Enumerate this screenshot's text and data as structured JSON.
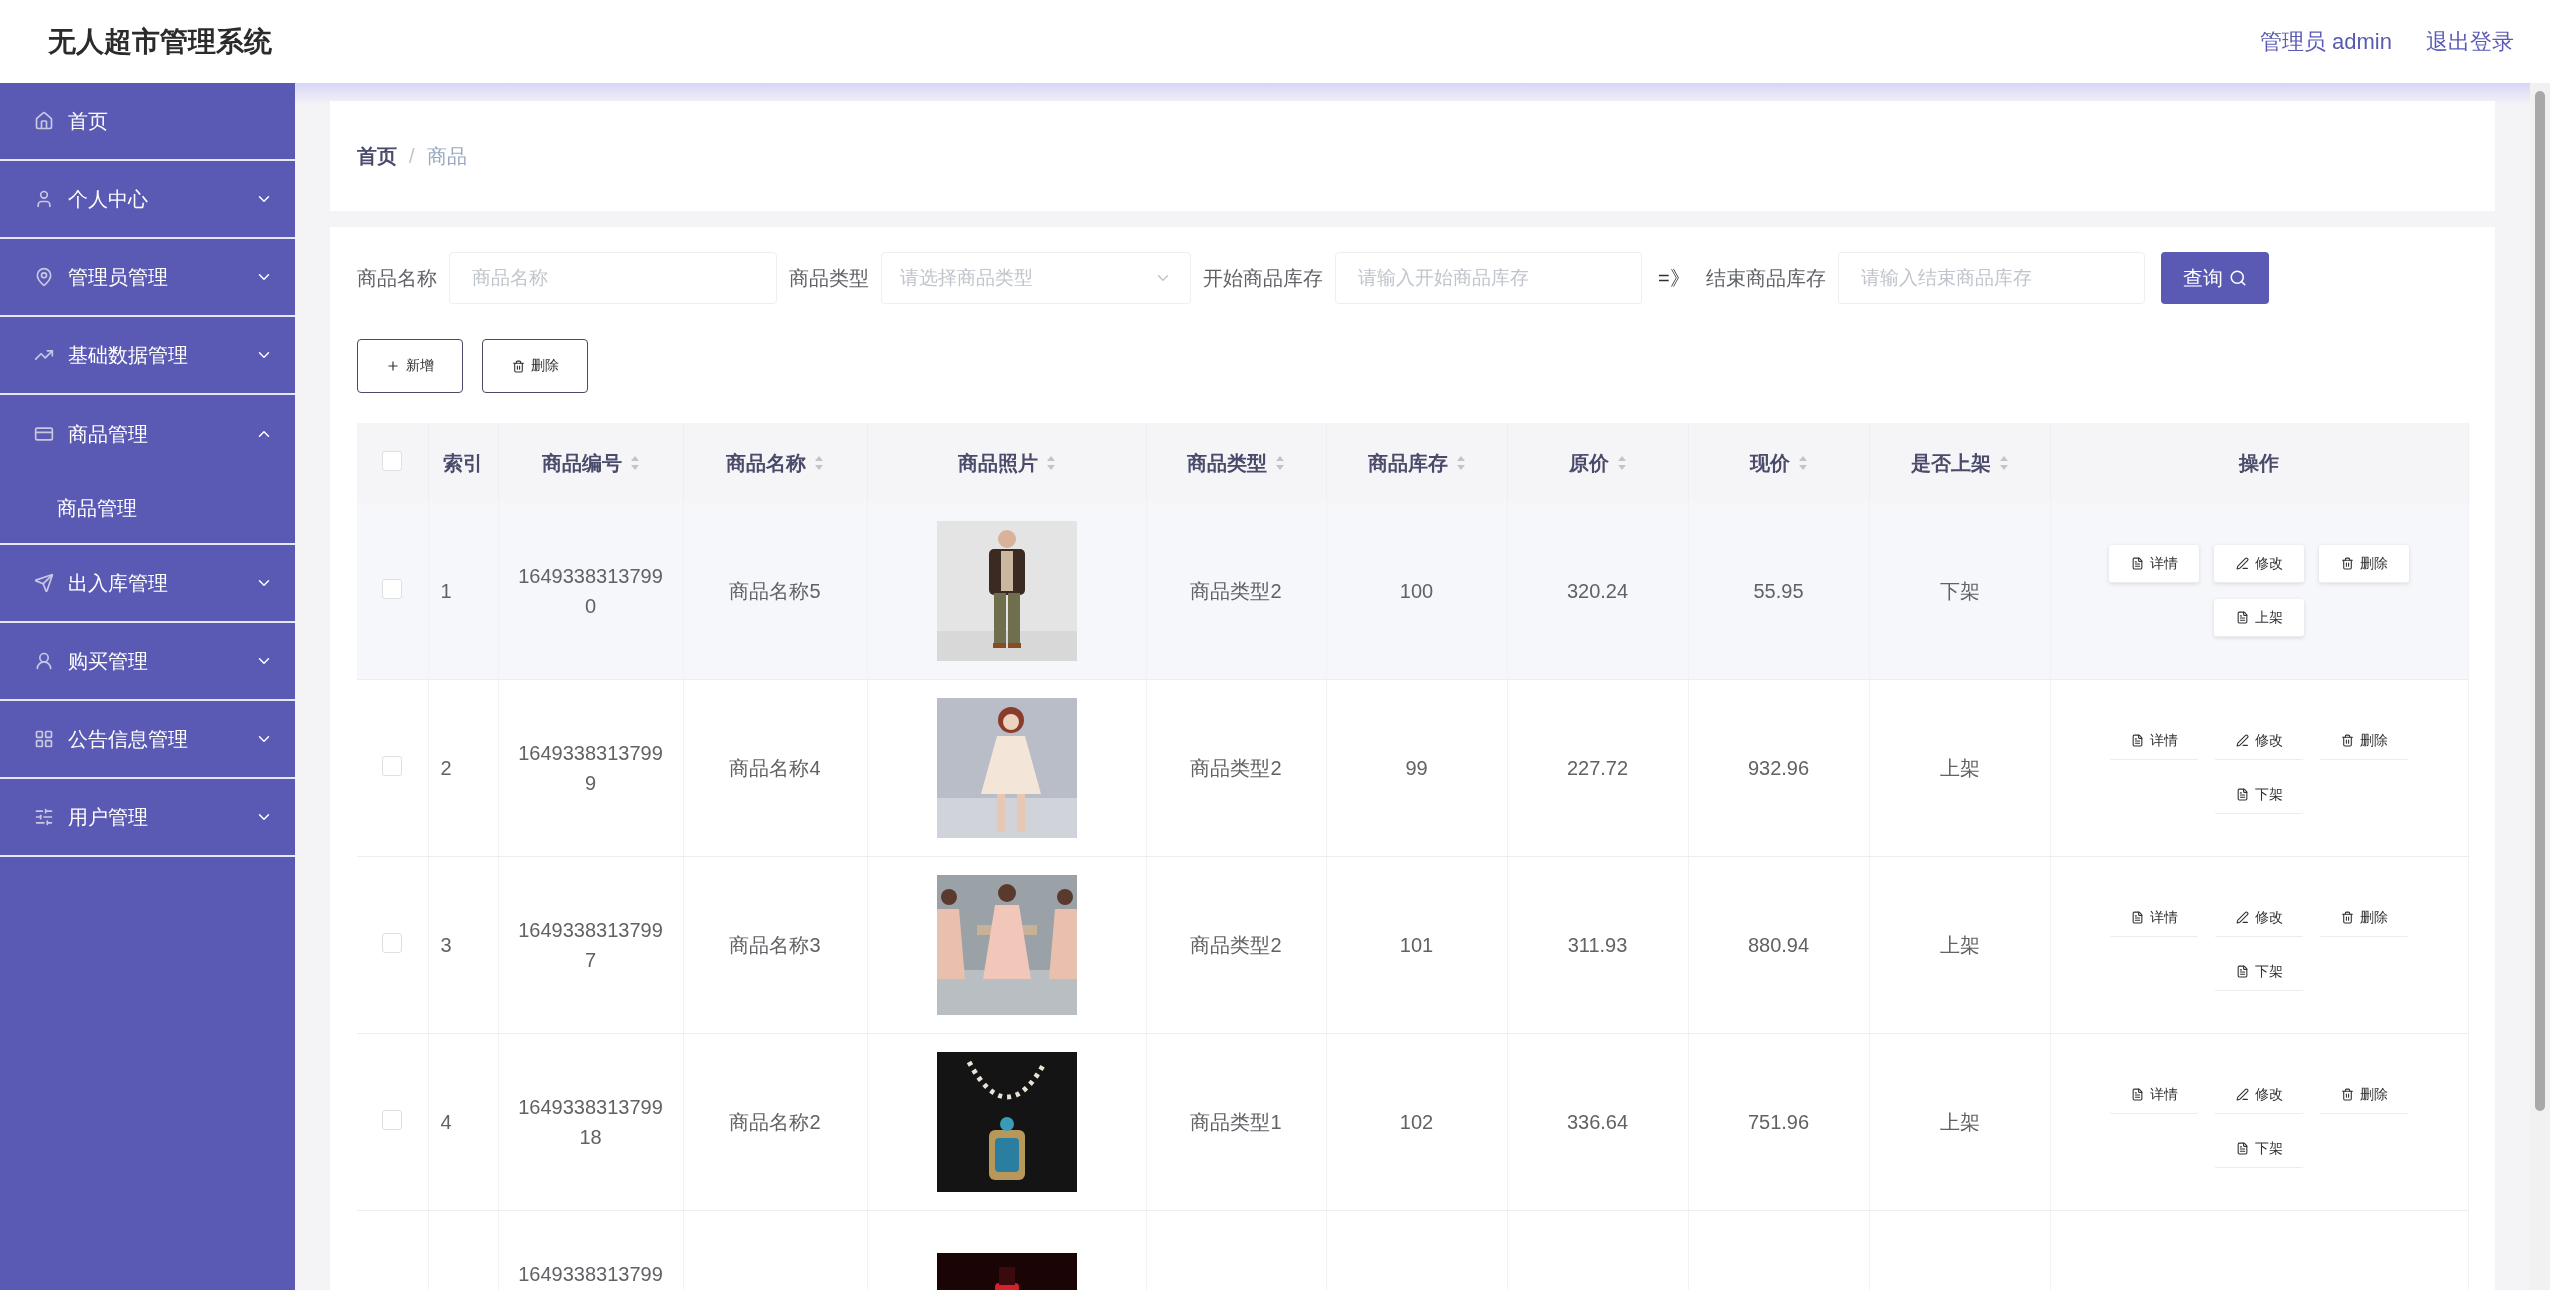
{
  "header": {
    "title": "无人超市管理系统",
    "user": "管理员 admin",
    "logout": "退出登录"
  },
  "sidebar": {
    "items": [
      {
        "label": "首页",
        "kind": "link"
      },
      {
        "label": "个人中心",
        "kind": "menu",
        "expanded": false
      },
      {
        "label": "管理员管理",
        "kind": "menu",
        "expanded": false
      },
      {
        "label": "基础数据管理",
        "kind": "menu",
        "expanded": false
      },
      {
        "label": "商品管理",
        "kind": "menu",
        "expanded": true,
        "children": [
          {
            "label": "商品管理"
          }
        ]
      },
      {
        "label": "出入库管理",
        "kind": "menu",
        "expanded": false
      },
      {
        "label": "购买管理",
        "kind": "menu",
        "expanded": false
      },
      {
        "label": "公告信息管理",
        "kind": "menu",
        "expanded": false
      },
      {
        "label": "用户管理",
        "kind": "menu",
        "expanded": false
      }
    ]
  },
  "breadcrumb": {
    "items": [
      "首页",
      "商品"
    ],
    "separator": "/"
  },
  "search": {
    "fields": [
      {
        "label": "商品名称",
        "kind": "input",
        "placeholder": "商品名称"
      },
      {
        "label": "商品类型",
        "kind": "select",
        "placeholder": "请选择商品类型"
      },
      {
        "label": "开始商品库存",
        "kind": "input",
        "placeholder": "请输入开始商品库存"
      },
      {
        "label": "结束商品库存",
        "kind": "input",
        "placeholder": "请输入结束商品库存"
      }
    ],
    "range_separator": "=》",
    "button": "查询"
  },
  "actions": [
    {
      "label": "新增",
      "kind": "add"
    },
    {
      "label": "删除",
      "kind": "delete"
    }
  ],
  "table": {
    "select_all": {
      "checked": false
    },
    "columns": [
      {
        "label": "索引",
        "sortable": false
      },
      {
        "label": "商品编号",
        "sortable": true
      },
      {
        "label": "商品名称",
        "sortable": true
      },
      {
        "label": "商品照片",
        "sortable": true
      },
      {
        "label": "商品类型",
        "sortable": true
      },
      {
        "label": "商品库存",
        "sortable": true
      },
      {
        "label": "原价",
        "sortable": true
      },
      {
        "label": "现价",
        "sortable": true
      },
      {
        "label": "是否上架",
        "sortable": true
      },
      {
        "label": "操作",
        "sortable": false
      }
    ],
    "rows": [
      {
        "checked": false,
        "highlighted": true,
        "index": "1",
        "code": "16493383137990",
        "name": "商品名称5",
        "photo": {
          "kind": "picture"
        },
        "type": "商品类型2",
        "stock": "100",
        "original_price": "320.24",
        "price": "55.95",
        "on_shelf": "下架",
        "actions": [
          {
            "label": "详情",
            "kind": "detail"
          },
          {
            "label": "修改",
            "kind": "edit"
          },
          {
            "label": "删除",
            "kind": "delete"
          },
          {
            "label": "上架",
            "kind": "toggle"
          }
        ]
      },
      {
        "checked": false,
        "highlighted": false,
        "index": "2",
        "code": "16493383137999",
        "name": "商品名称4",
        "photo": {
          "kind": "picture"
        },
        "type": "商品类型2",
        "stock": "99",
        "original_price": "227.72",
        "price": "932.96",
        "on_shelf": "上架",
        "actions": [
          {
            "label": "详情",
            "kind": "detail"
          },
          {
            "label": "修改",
            "kind": "edit"
          },
          {
            "label": "删除",
            "kind": "delete"
          },
          {
            "label": "下架",
            "kind": "toggle"
          }
        ]
      },
      {
        "checked": false,
        "highlighted": false,
        "index": "3",
        "code": "16493383137997",
        "name": "商品名称3",
        "photo": {
          "kind": "picture"
        },
        "type": "商品类型2",
        "stock": "101",
        "original_price": "311.93",
        "price": "880.94",
        "on_shelf": "上架",
        "actions": [
          {
            "label": "详情",
            "kind": "detail"
          },
          {
            "label": "修改",
            "kind": "edit"
          },
          {
            "label": "删除",
            "kind": "delete"
          },
          {
            "label": "下架",
            "kind": "toggle"
          }
        ]
      },
      {
        "checked": false,
        "highlighted": false,
        "index": "4",
        "code": "164933831379918",
        "name": "商品名称2",
        "photo": {
          "kind": "picture"
        },
        "type": "商品类型1",
        "stock": "102",
        "original_price": "336.64",
        "price": "751.96",
        "on_shelf": "上架",
        "actions": [
          {
            "label": "详情",
            "kind": "detail"
          },
          {
            "label": "修改",
            "kind": "edit"
          },
          {
            "label": "删除",
            "kind": "delete"
          },
          {
            "label": "下架",
            "kind": "toggle"
          }
        ]
      },
      {
        "code": "1649338313799",
        "photo": {
          "kind": "picture"
        }
      }
    ]
  }
}
